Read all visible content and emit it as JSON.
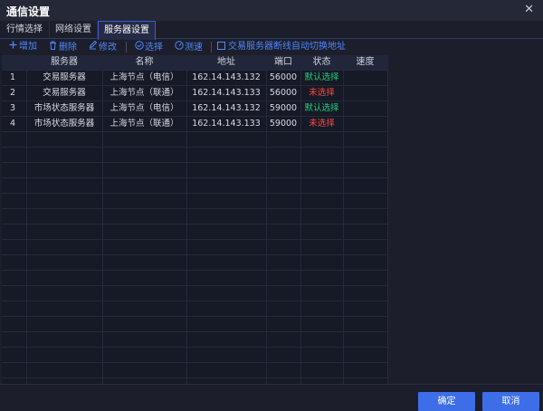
{
  "window": {
    "title": "通信设置",
    "close_glyph": "✕"
  },
  "tabs": [
    {
      "label": "行情选择",
      "active": false
    },
    {
      "label": "网络设置",
      "active": false
    },
    {
      "label": "服务器设置",
      "active": true
    }
  ],
  "toolbar": {
    "add": "增加",
    "delete": "删除",
    "edit": "修改",
    "select": "选择",
    "speed_test": "测速",
    "auto_switch": "交易服务器断线自动切换地址",
    "icons": {
      "add": "plus-icon",
      "delete": "trash-icon",
      "edit": "edit-icon",
      "select": "check-circle-icon",
      "speed_test": "gauge-icon"
    }
  },
  "table": {
    "columns": [
      "",
      "服务器",
      "名称",
      "地址",
      "端口",
      "状态",
      "速度"
    ],
    "rows": [
      {
        "idx": "1",
        "server": "交易服务器",
        "name": "上海节点（电信）",
        "address": "162.14.143.132",
        "port": "56000",
        "status": "默认选择",
        "status_type": "default",
        "speed": ""
      },
      {
        "idx": "2",
        "server": "交易服务器",
        "name": "上海节点（联通）",
        "address": "162.14.143.133",
        "port": "56000",
        "status": "未选择",
        "status_type": "none",
        "speed": ""
      },
      {
        "idx": "3",
        "server": "市场状态服务器",
        "name": "上海节点（电信）",
        "address": "162.14.143.132",
        "port": "59000",
        "status": "默认选择",
        "status_type": "default",
        "speed": ""
      },
      {
        "idx": "4",
        "server": "市场状态服务器",
        "name": "上海节点（联通）",
        "address": "162.14.143.133",
        "port": "59000",
        "status": "未选择",
        "status_type": "none",
        "speed": ""
      }
    ]
  },
  "footer": {
    "ok": "确定",
    "cancel": "取消"
  },
  "colors": {
    "accent": "#3d6ee8",
    "link": "#4f86ff",
    "status_default": "#1fd07a",
    "status_none": "#ff4a3d"
  }
}
